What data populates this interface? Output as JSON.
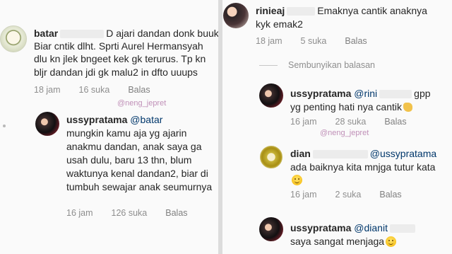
{
  "left": {
    "watermark_top": "@neng_jepret",
    "c1": {
      "user": "batar",
      "text_lines": [
        "D ajari dandan donk buuk",
        "Biar cntik dlht. Sprti Aurel Hermansyah",
        "dlu kn jlek bngeet kek gk terurus. Tp kn",
        "bljr dandan jdi gk malu2 in dfto uuups"
      ],
      "time": "18 jam",
      "likes": "16 suka",
      "reply": "Balas"
    },
    "c2": {
      "user": "ussypratama",
      "mention": "@batar",
      "text_lines": [
        "mungkin kamu aja yg ajarin",
        "anakmu dandan, anak saya ga",
        "usah dulu, baru 13 thn, blum",
        "waktunya kenal dandan2, biar di",
        "tumbuh sewajar anak seumurnya"
      ],
      "time": "16 jam",
      "likes": "126 suka",
      "reply": "Balas"
    }
  },
  "right": {
    "c1": {
      "user": "rinieaj",
      "text_lines": [
        "Emaknya cantik anaknya",
        "kyk emak2"
      ],
      "time": "18 jam",
      "likes": "5 suka",
      "reply": "Balas"
    },
    "hide_replies": "Sembunyikan balasan",
    "c2": {
      "user": "ussypratama",
      "mention": "@rini",
      "mention_tail": "gpp",
      "text_lines": [
        "yg penting hati nya cantik"
      ],
      "time": "16 jam",
      "likes": "28 suka",
      "reply": "Balas"
    },
    "watermark_mid": "@neng_jepret",
    "c3": {
      "user": "dian",
      "mention": "@ussypratama",
      "text_lines": [
        "ada baiknya kita mnjga tutur kata"
      ],
      "time": "16 jam",
      "likes": "2 suka",
      "reply": "Balas"
    },
    "c4": {
      "user": "ussypratama",
      "mention": "@dianit",
      "text_lines": [
        "saya sangat menjaga"
      ]
    }
  }
}
